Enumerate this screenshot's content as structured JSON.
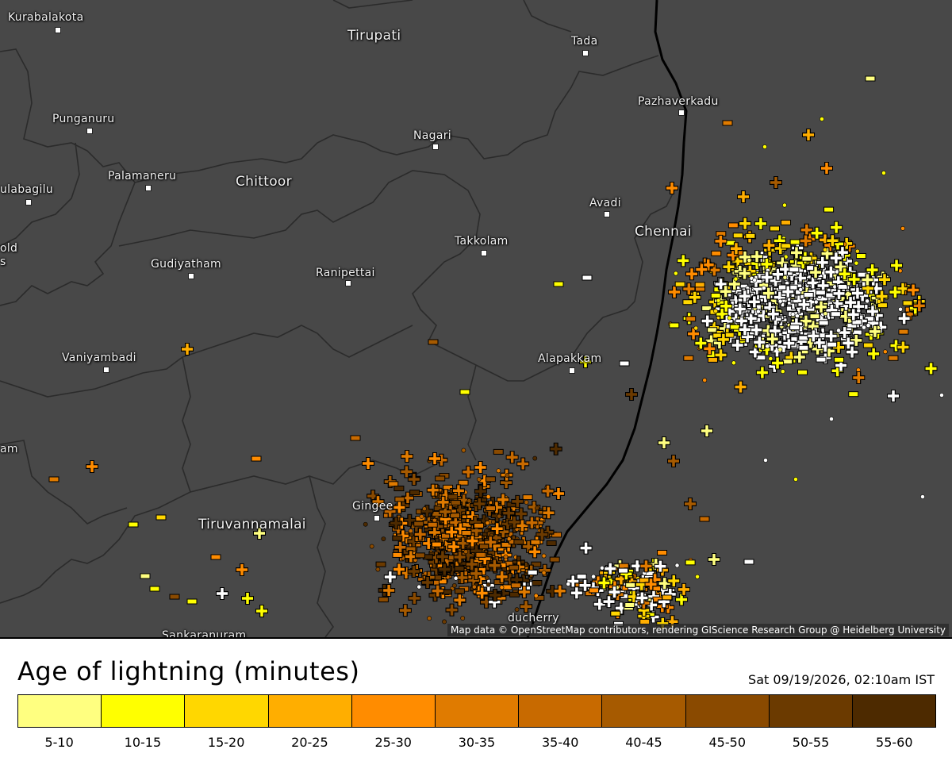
{
  "map": {
    "places": [
      {
        "name": "Kurabalakota",
        "big": false
      },
      {
        "name": "Tirupati",
        "big": true
      },
      {
        "name": "Tada",
        "big": false
      },
      {
        "name": "Pazhaverkadu",
        "big": false
      },
      {
        "name": "Punganuru",
        "big": false
      },
      {
        "name": "Nagari",
        "big": false
      },
      {
        "name": "Palamaneru",
        "big": false
      },
      {
        "name": "Chittoor",
        "big": true
      },
      {
        "name": "ulabagilu",
        "big": false
      },
      {
        "name": "Avadi",
        "big": false
      },
      {
        "name": "Chennai",
        "big": true
      },
      {
        "name": "Takkolam",
        "big": false
      },
      {
        "name": "old",
        "big": false
      },
      {
        "name": "s",
        "big": false
      },
      {
        "name": "Gudiyatham",
        "big": false
      },
      {
        "name": "Ranipettai",
        "big": false
      },
      {
        "name": "Vaniyambadi",
        "big": false
      },
      {
        "name": "Alapakkam",
        "big": false
      },
      {
        "name": "am",
        "big": false
      },
      {
        "name": "Gingee",
        "big": false
      },
      {
        "name": "Tiruvannamalai",
        "big": true
      },
      {
        "name": "Sankaranuram",
        "big": false
      },
      {
        "name": "ducherry",
        "big": false
      }
    ],
    "attribution": "Map data © OpenStreetMap contributors, rendering GIScience Research Group @ Heidelberg University"
  },
  "legend": {
    "title": "Age of lightning (minutes)",
    "timestamp": "Sat 09/19/2026, 02:10am IST",
    "bins": [
      {
        "label": "5-10",
        "color": "#ffff80"
      },
      {
        "label": "10-15",
        "color": "#ffff00"
      },
      {
        "label": "15-20",
        "color": "#ffd700"
      },
      {
        "label": "20-25",
        "color": "#ffae00"
      },
      {
        "label": "25-30",
        "color": "#ff8c00"
      },
      {
        "label": "30-35",
        "color": "#e07b00"
      },
      {
        "label": "35-40",
        "color": "#c86a00"
      },
      {
        "label": "40-45",
        "color": "#a65a00"
      },
      {
        "label": "45-50",
        "color": "#8a4a00"
      },
      {
        "label": "50-55",
        "color": "#6b3a00"
      },
      {
        "label": "55-60",
        "color": "#4d2a00"
      }
    ]
  },
  "colors": {
    "map_background": "#484848",
    "boundary": "#2a2a2a",
    "coastline": "#000000",
    "recent_strike": "#ffffff"
  }
}
